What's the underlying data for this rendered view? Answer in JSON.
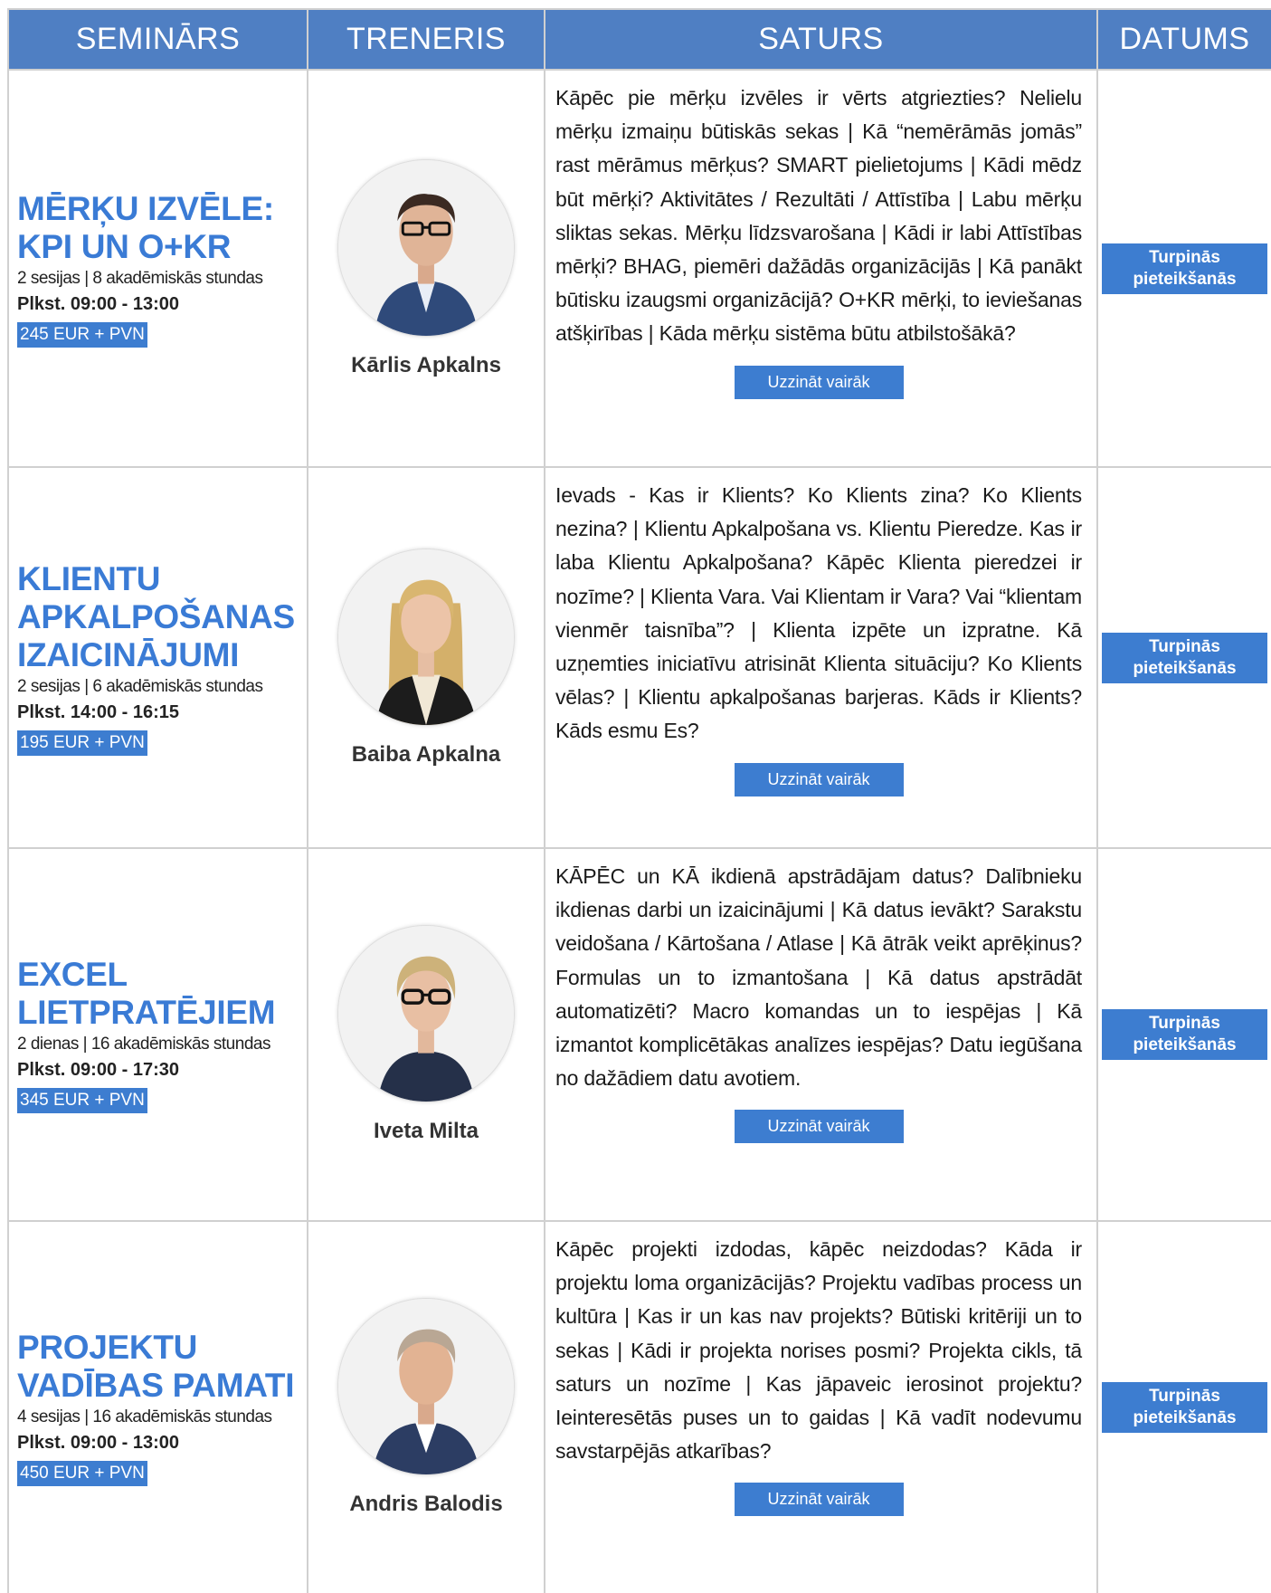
{
  "columns": {
    "seminar": "SEMINĀRS",
    "trainer": "TRENERIS",
    "content": "SATURS",
    "date": "DATUMS"
  },
  "rows": [
    {
      "title": "MĒRĶU IZVĒLE: KPI UN O+KR",
      "sessions": "2 sesijas | 8 akadēmiskās stundas",
      "time": "Plkst. 09:00 - 13:00",
      "price": "245 EUR + PVN",
      "trainer": "Kārlis Apkalns",
      "content": "Kāpēc pie mērķu izvēles ir vērts atgriezties? Nelielu mērķu izmaiņu būtiskās sekas | Kā “nemērāmās jomās” rast mērāmus mērķus? SMART pielietojums | Kādi mēdz būt mērķi? Aktivitātes / Rezultāti / Attīstība | Labu mērķu sliktas sekas. Mērķu līdzsvarošana | Kādi ir labi Attīstības mērķi? BHAG, piemēri dažādās organizācijās | Kā panākt būtisku izaugsmi organizācijā? O+KR mērķi, to ieviešanas atšķirības | Kāda mērķu sistēma būtu atbilstošākā?",
      "more": "Uzzināt vairāk",
      "apply": "Turpinās pieteikšanās"
    },
    {
      "title": "KLIENTU APKALPOŠANAS IZAICINĀJUMI",
      "sessions": "2 sesijas | 6 akadēmiskās stundas",
      "time": "Plkst. 14:00 - 16:15",
      "price": "195 EUR + PVN",
      "trainer": "Baiba Apkalna",
      "content": "Ievads - Kas ir Klients? Ko Klients zina? Ko Klients nezina? | Klientu Apkalpošana vs. Klientu Pieredze. Kas ir laba Klientu Apkalpošana? Kāpēc Klienta pieredzei ir nozīme? | Klienta Vara. Vai Klientam ir Vara? Vai “klientam vienmēr taisnība”? | Klienta izpēte un izpratne. Kā uzņemties iniciatīvu atrisināt Klienta situāciju? Ko Klients vēlas? | Klientu apkalpošanas barjeras. Kāds ir Klients? Kāds esmu Es?",
      "more": "Uzzināt vairāk",
      "apply": "Turpinās pieteikšanās"
    },
    {
      "title": "EXCEL LIETPRATĒJIEM",
      "sessions": "2 dienas | 16 akadēmiskās stundas",
      "time": "Plkst. 09:00 - 17:30",
      "price": "345 EUR + PVN",
      "trainer": "Iveta Milta",
      "content": "KĀPĒC un KĀ ikdienā apstrādājam datus? Dalībnieku ikdienas darbi un izaicinājumi | Kā datus ievākt? Sarakstu veidošana / Kārtošana / Atlase | Kā ātrāk veikt aprēķinus? Formulas un to izmantošana | Kā datus apstrādāt automatizēti? Macro komandas un to iespējas | Kā izmantot komplicētākas analīzes iespējas? Datu iegūšana no dažādiem datu avotiem.",
      "more": "Uzzināt vairāk",
      "apply": "Turpinās pieteikšanās"
    },
    {
      "title": "PROJEKTU VADĪBAS PAMATI",
      "sessions": "4 sesijas | 16 akadēmiskās stundas",
      "time": "Plkst. 09:00 - 13:00",
      "price": "450 EUR + PVN",
      "trainer": "Andris Balodis",
      "content": "Kāpēc projekti izdodas, kāpēc neizdodas? Kāda ir projektu loma organizācijās? Projektu vadības process un kultūra | Kas ir un kas nav projekts? Būtiski kritēriji un to sekas | Kādi ir projekta norises posmi? Projekta cikls, tā saturs un nozīme | Kas jāpaveic ierosinot projektu? Ieinteresētās puses un to gaidas | Kā vadīt nodevumu savstarpējās atkarības?",
      "more": "Uzzināt vairāk",
      "apply": "Turpinās pieteikšanās"
    }
  ]
}
